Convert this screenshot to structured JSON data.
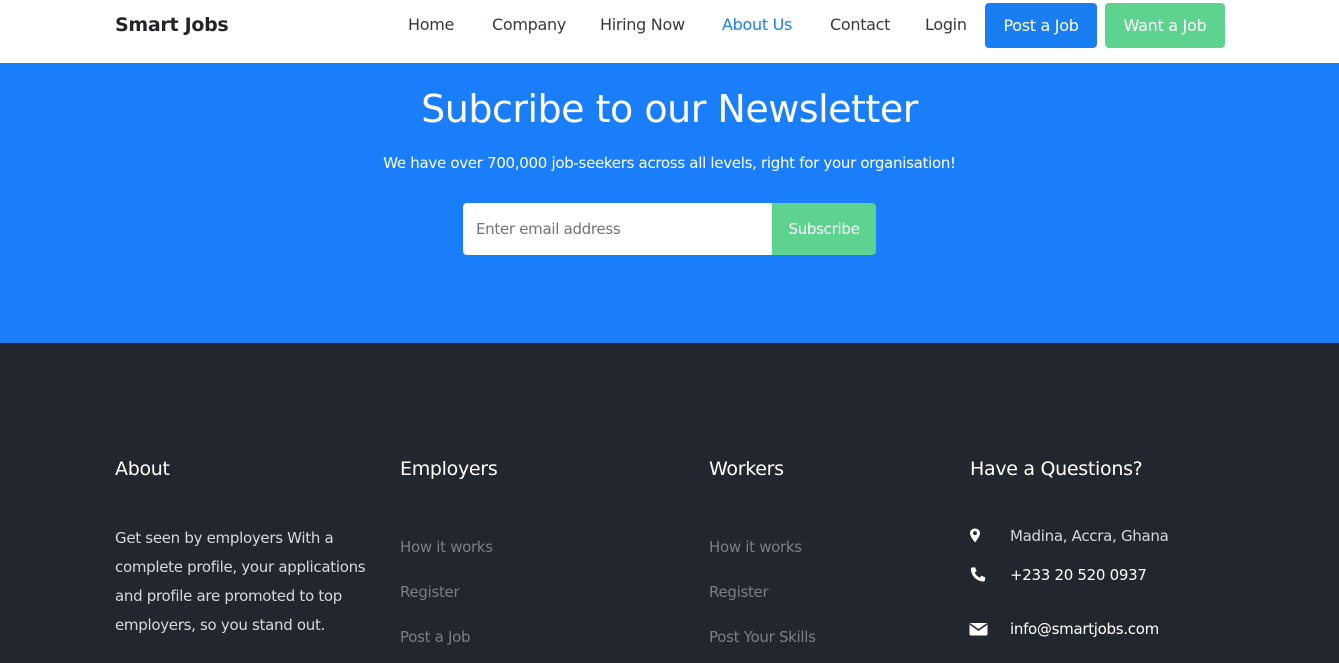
{
  "navbar": {
    "brand": "Smart Jobs",
    "links": [
      {
        "label": "Home"
      },
      {
        "label": "Company"
      },
      {
        "label": "Hiring Now"
      },
      {
        "label": "About Us",
        "active": true
      },
      {
        "label": "Contact"
      },
      {
        "label": "Login"
      }
    ],
    "post_job_label": "Post a Job",
    "want_job_label": "Want a Job"
  },
  "newsletter": {
    "title": "Subcribe to our Newsletter",
    "subtitle": "We have over 700,000 job-seekers across all levels, right for your organisation!",
    "email_placeholder": "Enter email address",
    "email_value": "",
    "subscribe_label": "Subscribe"
  },
  "footer": {
    "about": {
      "heading": "About",
      "text": "Get seen by employers With a complete profile, your applications and profile are promoted to top employers, so you stand out."
    },
    "employers": {
      "heading": "Employers",
      "links": [
        "How it works",
        "Register",
        "Post a Job"
      ]
    },
    "workers": {
      "heading": "Workers",
      "links": [
        "How it works",
        "Register",
        "Post Your Skills"
      ]
    },
    "contact": {
      "heading": "Have a Questions?",
      "address": "Madina, Accra, Ghana",
      "phone": "+233 20 520 0937",
      "email": "info@smartjobs.com",
      "icons": [
        "map-marker-icon",
        "phone-icon",
        "envelope-icon"
      ]
    }
  },
  "colors": {
    "primary": "#1a7efb",
    "success": "#5dd38f",
    "footer_bg": "#22262f",
    "active_link": "#1a7ef3"
  }
}
